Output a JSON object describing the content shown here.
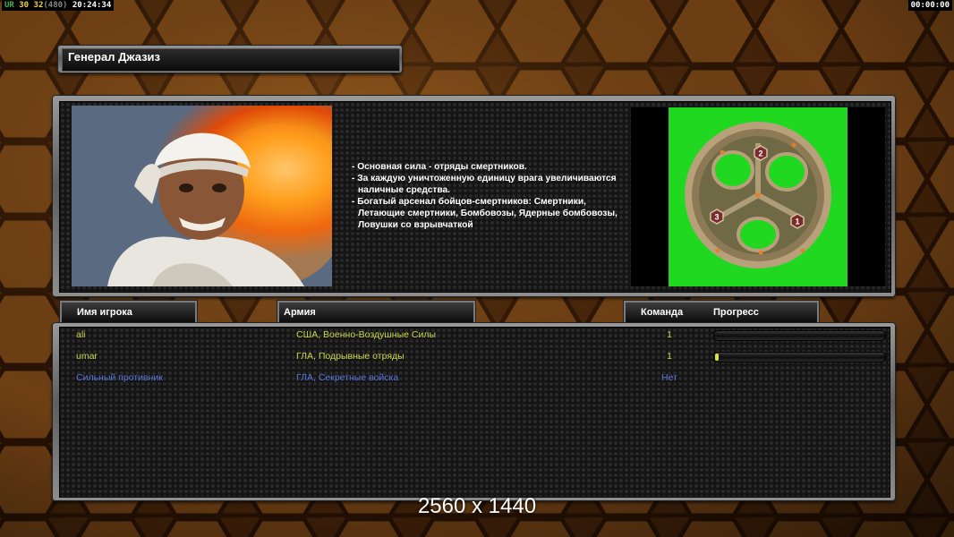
{
  "topbar": {
    "fps_prefix": "UR",
    "fps_value": "30",
    "fps_limit": "32",
    "fps_extra": "(480)",
    "time": "20:24:34",
    "game_clock": "00:00:00"
  },
  "general": {
    "name": "Генерал Джазиз",
    "description": [
      "- Основная сила - отряды смертников.",
      "- За каждую уничтоженную единицу врага увеличиваются наличные средства.",
      "- Богатый арсенал бойцов-смертников: Смертники, Летающие смертники, Бомбовозы, Ядерные бомбовозы, Ловушки со взрывчаткой"
    ]
  },
  "map": {
    "start_positions": [
      "1",
      "2",
      "3"
    ]
  },
  "columns": {
    "player": "Имя игрока",
    "army": "Армия",
    "team": "Команда",
    "progress": "Прогресс"
  },
  "players": [
    {
      "name": "ali",
      "army": "США, Военно-Воздушные Силы",
      "team": "1",
      "progress": 0.0,
      "color": "#c8d84a"
    },
    {
      "name": "umar",
      "army": "ГЛА, Подрывные отряды",
      "team": "1",
      "progress": 0.02,
      "color": "#c8d84a"
    },
    {
      "name": "Сильный противник",
      "army": "ГЛА, Секретные войска",
      "team": "Нет",
      "progress": null,
      "color": "#5a78e0"
    }
  ],
  "overlay": {
    "resolution": "2560 x 1440"
  },
  "colors": {
    "map_green": "#1fd81f",
    "progress_fill": "#d8e83a"
  }
}
